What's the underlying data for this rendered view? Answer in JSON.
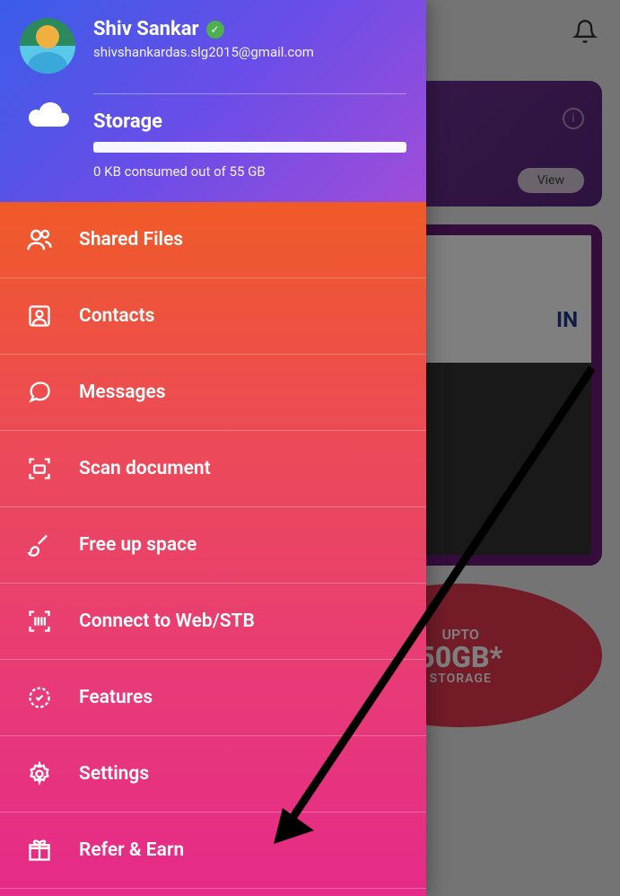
{
  "profile": {
    "name": "Shiv Sankar",
    "email": "shivshankardas.slg2015@gmail.com",
    "verified": true
  },
  "storage": {
    "title": "Storage",
    "usage_text": "0 KB consumed out of 55 GB"
  },
  "menu": {
    "items": [
      {
        "icon": "users-icon",
        "label": "Shared Files"
      },
      {
        "icon": "contact-icon",
        "label": "Contacts"
      },
      {
        "icon": "message-icon",
        "label": "Messages"
      },
      {
        "icon": "scan-icon",
        "label": "Scan document"
      },
      {
        "icon": "brush-icon",
        "label": "Free up space"
      },
      {
        "icon": "barcode-icon",
        "label": "Connect to Web/STB"
      },
      {
        "icon": "badge-icon",
        "label": "Features"
      },
      {
        "icon": "gear-icon",
        "label": "Settings"
      },
      {
        "icon": "gift-icon",
        "label": "Refer & Earn"
      }
    ]
  },
  "background": {
    "view_button": "View",
    "in_text": "IN",
    "promo": {
      "upto": "UPTO",
      "size": "50GB*",
      "label": "STORAGE"
    }
  }
}
